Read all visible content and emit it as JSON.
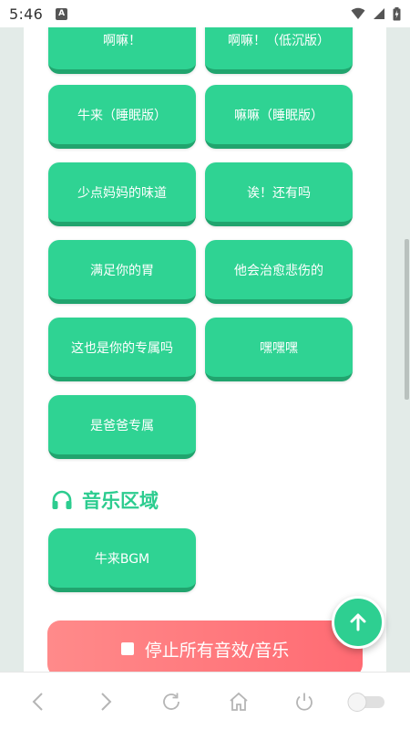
{
  "status_bar": {
    "time": "5:46",
    "app_icon_letter": "A"
  },
  "sound_buttons": [
    {
      "label": "啊嘛！"
    },
    {
      "label": "啊嘛！（低沉版）"
    },
    {
      "label": "牛来（睡眠版）"
    },
    {
      "label": "嘛嘛（睡眠版）"
    },
    {
      "label": "少点妈妈的味道"
    },
    {
      "label": "诶！还有吗"
    },
    {
      "label": "满足你的胃"
    },
    {
      "label": "他会治愈悲伤的"
    },
    {
      "label": "这也是你的专属吗"
    },
    {
      "label": "嘿嘿嘿"
    },
    {
      "label": "是爸爸专属"
    }
  ],
  "music_section": {
    "title": "音乐区域",
    "icon": "headphones-icon",
    "buttons": [
      {
        "label": "牛来BGM"
      }
    ]
  },
  "stop_button": {
    "label": "停止所有音效/音乐"
  },
  "colors": {
    "button_green": "#2fd393",
    "title_green": "#2ccc8f",
    "stop_red": "#ff6b73"
  }
}
